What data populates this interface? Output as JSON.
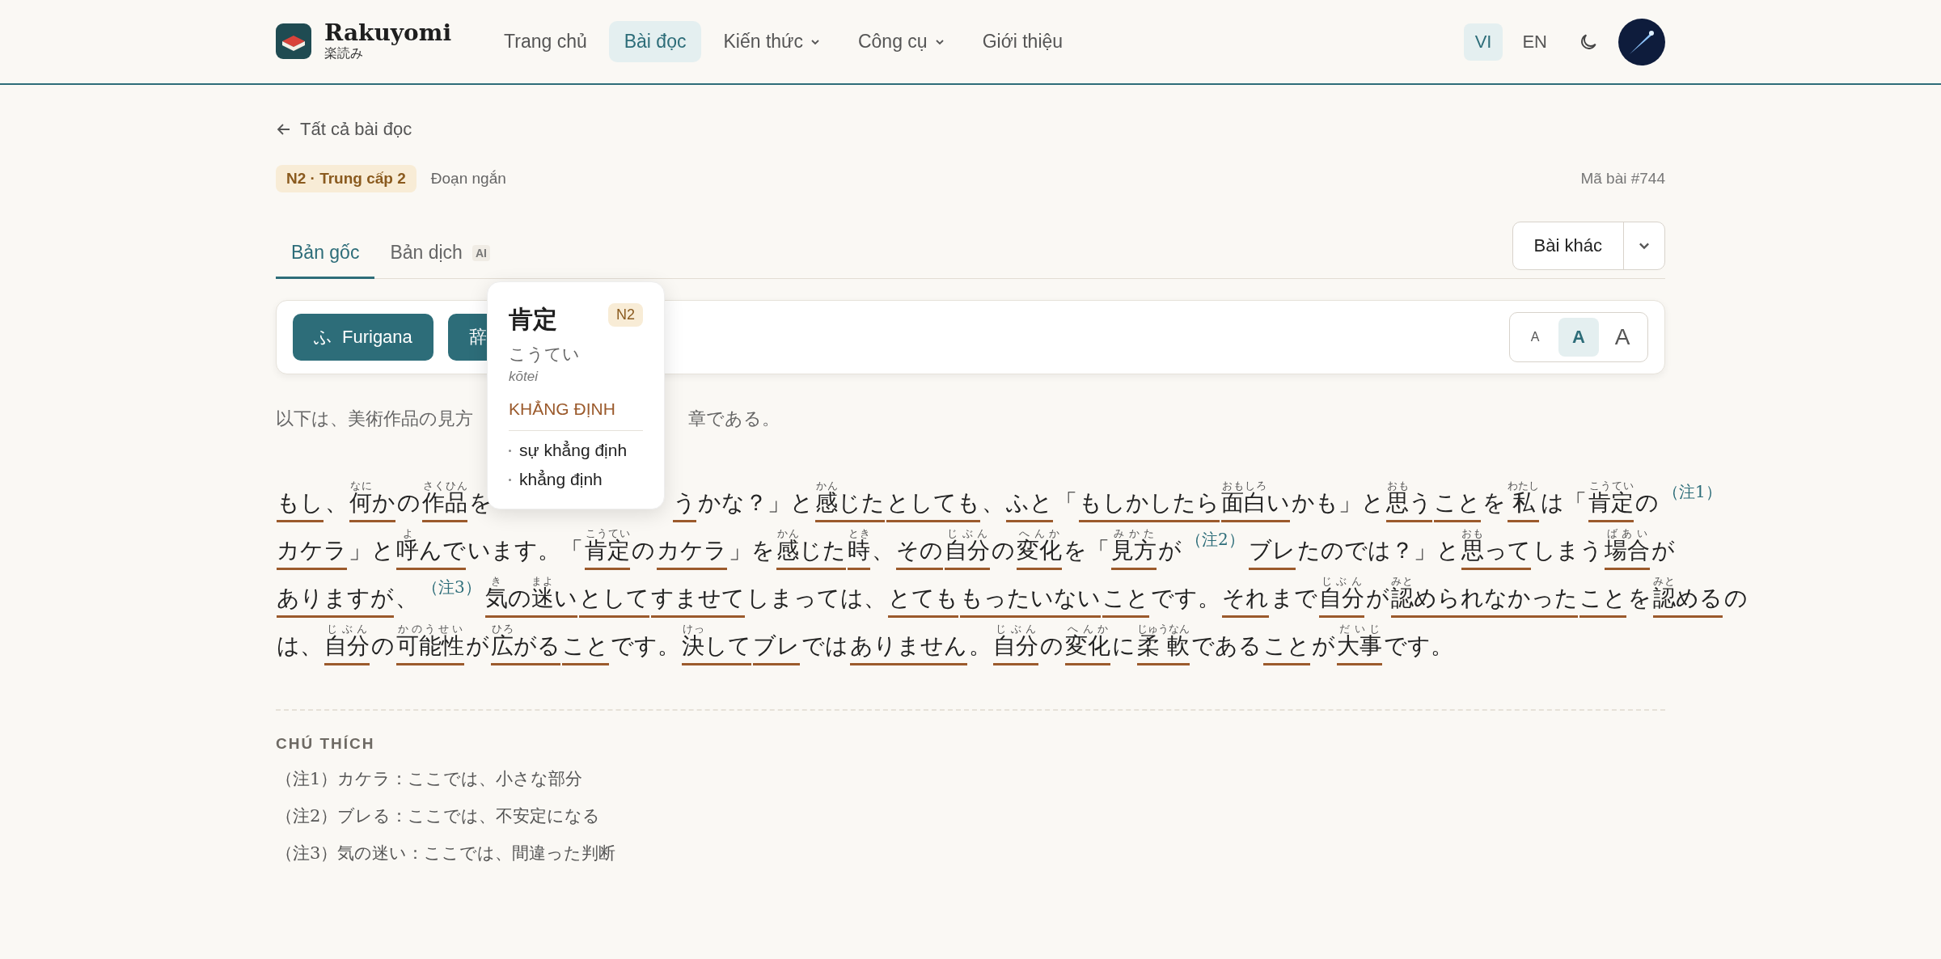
{
  "brand": {
    "name": "Rakuyomi",
    "subtitle": "楽読み"
  },
  "nav": [
    {
      "label": "Trang chủ",
      "selected": false,
      "has_menu": false
    },
    {
      "label": "Bài đọc",
      "selected": true,
      "has_menu": false
    },
    {
      "label": "Kiến thức",
      "selected": false,
      "has_menu": true
    },
    {
      "label": "Công cụ",
      "selected": false,
      "has_menu": true
    },
    {
      "label": "Giới thiệu",
      "selected": false,
      "has_menu": false
    }
  ],
  "languages": [
    {
      "label": "VI",
      "selected": true
    },
    {
      "label": "EN",
      "selected": false
    }
  ],
  "back_link": "Tất cả bài đọc",
  "level_badge": "N2 · Trung cấp 2",
  "length_label": "Đoạn ngắn",
  "article_id": "Mã bài #744",
  "tabs": [
    {
      "label": "Bản gốc",
      "selected": true
    },
    {
      "label": "Bản dịch",
      "selected": false,
      "badge": "AI"
    }
  ],
  "other_button": "Bài khác",
  "toolbar": {
    "buttons": [
      {
        "icon": "ふ",
        "label": "Furigana"
      },
      {
        "icon": "辞"
      }
    ],
    "font_sizes": [
      {
        "label": "A",
        "selected": false
      },
      {
        "label": "A",
        "selected": true
      },
      {
        "label": "A",
        "selected": false
      }
    ]
  },
  "popup": {
    "word": "肯定",
    "level": "N2",
    "reading": "こうてい",
    "romaji": "kōtei",
    "meaning": "KHẲNG ĐỊNH",
    "senses": [
      "sự khẳng định",
      "khẳng định"
    ]
  },
  "intro": [
    "以下は、美術作品の見方",
    "章である。"
  ],
  "passage": [
    [
      {
        "kind": "word",
        "parts": [
          "もし"
        ]
      },
      {
        "kind": "plain",
        "parts": [
          "、"
        ]
      },
      {
        "kind": "word",
        "parts": [
          {
            "base": "何",
            "ruby": "なに"
          },
          "か"
        ]
      },
      {
        "kind": "plain",
        "parts": [
          "の"
        ]
      },
      {
        "kind": "word",
        "parts": [
          {
            "base": "作品",
            "ruby": "さくひん"
          }
        ]
      },
      {
        "kind": "plain",
        "parts": [
          "を"
        ]
      },
      {
        "kind": "gap"
      },
      {
        "kind": "word",
        "parts": [
          "う"
        ]
      },
      {
        "kind": "plain",
        "parts": [
          "かな？」と"
        ]
      },
      {
        "kind": "word",
        "parts": [
          {
            "base": "感",
            "ruby": "かん"
          },
          "じた"
        ]
      },
      {
        "kind": "word",
        "parts": [
          "としても"
        ]
      },
      {
        "kind": "plain",
        "parts": [
          "、"
        ]
      },
      {
        "kind": "word",
        "parts": [
          "ふと"
        ]
      },
      {
        "kind": "plain",
        "parts": [
          "「"
        ]
      },
      {
        "kind": "word",
        "parts": [
          "もしかしたら"
        ]
      },
      {
        "kind": "word",
        "parts": [
          {
            "base": "面白",
            "ruby": "おもしろ"
          },
          "い"
        ]
      },
      {
        "kind": "plain",
        "parts": [
          "かも」と"
        ]
      },
      {
        "kind": "word",
        "parts": [
          {
            "base": "思",
            "ruby": "おも"
          },
          "う"
        ]
      },
      {
        "kind": "word",
        "parts": [
          "こと"
        ]
      },
      {
        "kind": "plain",
        "parts": [
          "を"
        ]
      },
      {
        "kind": "word",
        "parts": [
          {
            "base": "私",
            "ruby": "わたし"
          }
        ]
      },
      {
        "kind": "plain",
        "parts": [
          "は「"
        ]
      },
      {
        "kind": "word",
        "parts": [
          {
            "base": "肯定",
            "ruby": "こうてい"
          }
        ]
      },
      {
        "kind": "plain",
        "parts": [
          "の"
        ]
      },
      {
        "kind": "note",
        "text": "（注1）"
      }
    ],
    [
      {
        "kind": "word",
        "parts": [
          "カケラ"
        ]
      },
      {
        "kind": "plain",
        "parts": [
          "」と"
        ]
      },
      {
        "kind": "word",
        "parts": [
          {
            "base": "呼",
            "ruby": "よ"
          },
          "んで"
        ]
      },
      {
        "kind": "plain",
        "parts": [
          "います。「"
        ]
      },
      {
        "kind": "word",
        "parts": [
          {
            "base": "肯定",
            "ruby": "こうてい"
          }
        ]
      },
      {
        "kind": "plain",
        "parts": [
          "の"
        ]
      },
      {
        "kind": "word",
        "parts": [
          "カケラ"
        ]
      },
      {
        "kind": "plain",
        "parts": [
          "」を"
        ]
      },
      {
        "kind": "word",
        "parts": [
          {
            "base": "感",
            "ruby": "かん"
          },
          "じた"
        ]
      },
      {
        "kind": "word",
        "parts": [
          {
            "base": "時",
            "ruby": "とき"
          }
        ]
      },
      {
        "kind": "plain",
        "parts": [
          "、"
        ]
      },
      {
        "kind": "word",
        "parts": [
          "その"
        ]
      },
      {
        "kind": "word",
        "parts": [
          {
            "base": "自分",
            "ruby": "じぶん"
          }
        ]
      },
      {
        "kind": "plain",
        "parts": [
          "の"
        ]
      },
      {
        "kind": "word",
        "parts": [
          {
            "base": "変化",
            "ruby": "へんか"
          }
        ]
      },
      {
        "kind": "plain",
        "parts": [
          "を「"
        ]
      },
      {
        "kind": "word",
        "parts": [
          {
            "base": "見方",
            "ruby": "みかた"
          }
        ]
      },
      {
        "kind": "plain",
        "parts": [
          "が"
        ]
      },
      {
        "kind": "note",
        "text": "（注2）"
      },
      {
        "kind": "word",
        "parts": [
          "ブレ"
        ]
      },
      {
        "kind": "plain",
        "parts": [
          "たのでは？」と"
        ]
      },
      {
        "kind": "word",
        "parts": [
          {
            "base": "思",
            "ruby": "おも"
          },
          "って"
        ]
      },
      {
        "kind": "plain",
        "parts": [
          "しまう"
        ]
      },
      {
        "kind": "word",
        "parts": [
          {
            "base": "場合",
            "ruby": "ばあい"
          }
        ]
      },
      {
        "kind": "plain",
        "parts": [
          "が"
        ]
      }
    ],
    [
      {
        "kind": "word",
        "parts": [
          "ありますが"
        ]
      },
      {
        "kind": "plain",
        "parts": [
          "、"
        ]
      },
      {
        "kind": "note",
        "text": "（注3）"
      },
      {
        "kind": "word",
        "parts": [
          {
            "base": "気",
            "ruby": "き"
          },
          "の",
          {
            "base": "迷",
            "ruby": "まよ"
          },
          "い"
        ]
      },
      {
        "kind": "word",
        "parts": [
          "として"
        ]
      },
      {
        "kind": "word",
        "parts": [
          "すませて"
        ]
      },
      {
        "kind": "plain",
        "parts": [
          "しまっては、"
        ]
      },
      {
        "kind": "word",
        "parts": [
          "とても"
        ]
      },
      {
        "kind": "word",
        "parts": [
          "もったいない"
        ]
      },
      {
        "kind": "word",
        "parts": [
          "こと"
        ]
      },
      {
        "kind": "plain",
        "parts": [
          "です。"
        ]
      },
      {
        "kind": "word",
        "parts": [
          "それ"
        ]
      },
      {
        "kind": "plain",
        "parts": [
          "まで"
        ]
      },
      {
        "kind": "word",
        "parts": [
          {
            "base": "自分",
            "ruby": "じぶん"
          }
        ]
      },
      {
        "kind": "plain",
        "parts": [
          "が"
        ]
      },
      {
        "kind": "word",
        "parts": [
          {
            "base": "認",
            "ruby": "みと"
          },
          "められなかった"
        ]
      },
      {
        "kind": "word",
        "parts": [
          "こと"
        ]
      },
      {
        "kind": "plain",
        "parts": [
          "を"
        ]
      },
      {
        "kind": "word",
        "parts": [
          {
            "base": "認",
            "ruby": "みと"
          },
          "める"
        ]
      },
      {
        "kind": "plain",
        "parts": [
          "の"
        ]
      }
    ],
    [
      {
        "kind": "plain",
        "parts": [
          "は、"
        ]
      },
      {
        "kind": "word",
        "parts": [
          {
            "base": "自分",
            "ruby": "じぶん"
          }
        ]
      },
      {
        "kind": "plain",
        "parts": [
          "の"
        ]
      },
      {
        "kind": "word",
        "parts": [
          {
            "base": "可能性",
            "ruby": "かのうせい"
          }
        ]
      },
      {
        "kind": "plain",
        "parts": [
          "が"
        ]
      },
      {
        "kind": "word",
        "parts": [
          {
            "base": "広",
            "ruby": "ひろ"
          },
          "がる"
        ]
      },
      {
        "kind": "word",
        "parts": [
          "こと"
        ]
      },
      {
        "kind": "plain",
        "parts": [
          "です。"
        ]
      },
      {
        "kind": "word",
        "parts": [
          {
            "base": "決",
            "ruby": "けっ"
          },
          "して"
        ]
      },
      {
        "kind": "word",
        "parts": [
          "ブレ"
        ]
      },
      {
        "kind": "plain",
        "parts": [
          "では"
        ]
      },
      {
        "kind": "word",
        "parts": [
          "ありません"
        ]
      },
      {
        "kind": "plain",
        "parts": [
          "。"
        ]
      },
      {
        "kind": "word",
        "parts": [
          {
            "base": "自分",
            "ruby": "じぶん"
          }
        ]
      },
      {
        "kind": "plain",
        "parts": [
          "の"
        ]
      },
      {
        "kind": "word",
        "parts": [
          {
            "base": "変化",
            "ruby": "へんか"
          }
        ]
      },
      {
        "kind": "plain",
        "parts": [
          "に"
        ]
      },
      {
        "kind": "word",
        "parts": [
          {
            "base": "柔 軟",
            "ruby": "じゅうなん"
          }
        ]
      },
      {
        "kind": "plain",
        "parts": [
          "である"
        ]
      },
      {
        "kind": "word",
        "parts": [
          "こと"
        ]
      },
      {
        "kind": "plain",
        "parts": [
          "が"
        ]
      },
      {
        "kind": "word",
        "parts": [
          {
            "base": "大事",
            "ruby": "だいじ"
          }
        ]
      },
      {
        "kind": "plain",
        "parts": [
          "です。"
        ]
      }
    ]
  ],
  "notes_title": "CHÚ THÍCH",
  "notes": [
    "（注1）カケラ：ここでは、小さな部分",
    "（注2）ブレる：ここでは、不安定になる",
    "（注3）気の迷い：ここでは、間違った判断"
  ]
}
